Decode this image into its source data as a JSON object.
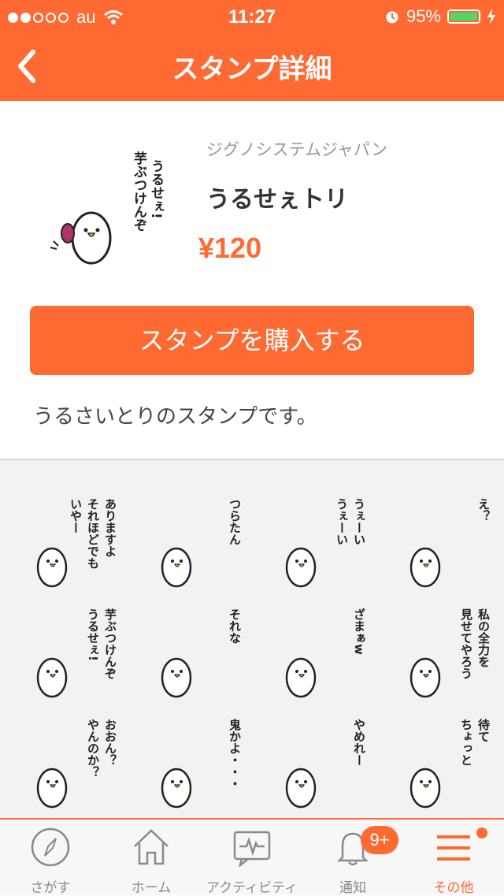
{
  "status": {
    "carrier": "au",
    "time": "11:27",
    "battery": "95%",
    "signal_bars_filled": 2,
    "signal_bars_total": 5
  },
  "nav": {
    "title": "スタンプ詳細"
  },
  "product": {
    "publisher": "ジグノシステムジャパン",
    "name": "うるせぇトリ",
    "price": "¥120",
    "buy_label": "スタンプを購入する",
    "description": "うるさいとりのスタンプです。"
  },
  "main_sticker": {
    "text_lines": [
      "うるせぇ!",
      "芋ぶつけんぞ"
    ]
  },
  "stickers": [
    {
      "lines": [
        "いやー",
        "それほどでも",
        "ありますよ"
      ]
    },
    {
      "lines": [
        "つらたん"
      ]
    },
    {
      "lines": [
        "うぇーい",
        "うぇーい"
      ]
    },
    {
      "lines": [
        "え？"
      ]
    },
    {
      "lines": [
        "うるせぇ!",
        "芋ぶつけんぞ"
      ]
    },
    {
      "lines": [
        "それな"
      ]
    },
    {
      "lines": [
        "ざまぁw"
      ]
    },
    {
      "lines": [
        "見せてやろう",
        "私の全力を"
      ]
    },
    {
      "lines": [
        "やんのか？",
        "おおん？"
      ]
    },
    {
      "lines": [
        "鬼かよ・・・"
      ]
    },
    {
      "lines": [
        "やめれー"
      ]
    },
    {
      "lines": [
        "ちょっと",
        "待て"
      ]
    }
  ],
  "tabs": [
    {
      "label": "さがす",
      "icon": "compass-icon"
    },
    {
      "label": "ホーム",
      "icon": "home-icon"
    },
    {
      "label": "アクティビティ",
      "icon": "activity-icon"
    },
    {
      "label": "通知",
      "icon": "bell-icon",
      "badge": "9+"
    },
    {
      "label": "その他",
      "icon": "menu-icon",
      "active": true
    }
  ],
  "colors": {
    "accent": "#ff6a33",
    "battery": "#4cd964",
    "grid_bg": "#f2f2f2"
  }
}
